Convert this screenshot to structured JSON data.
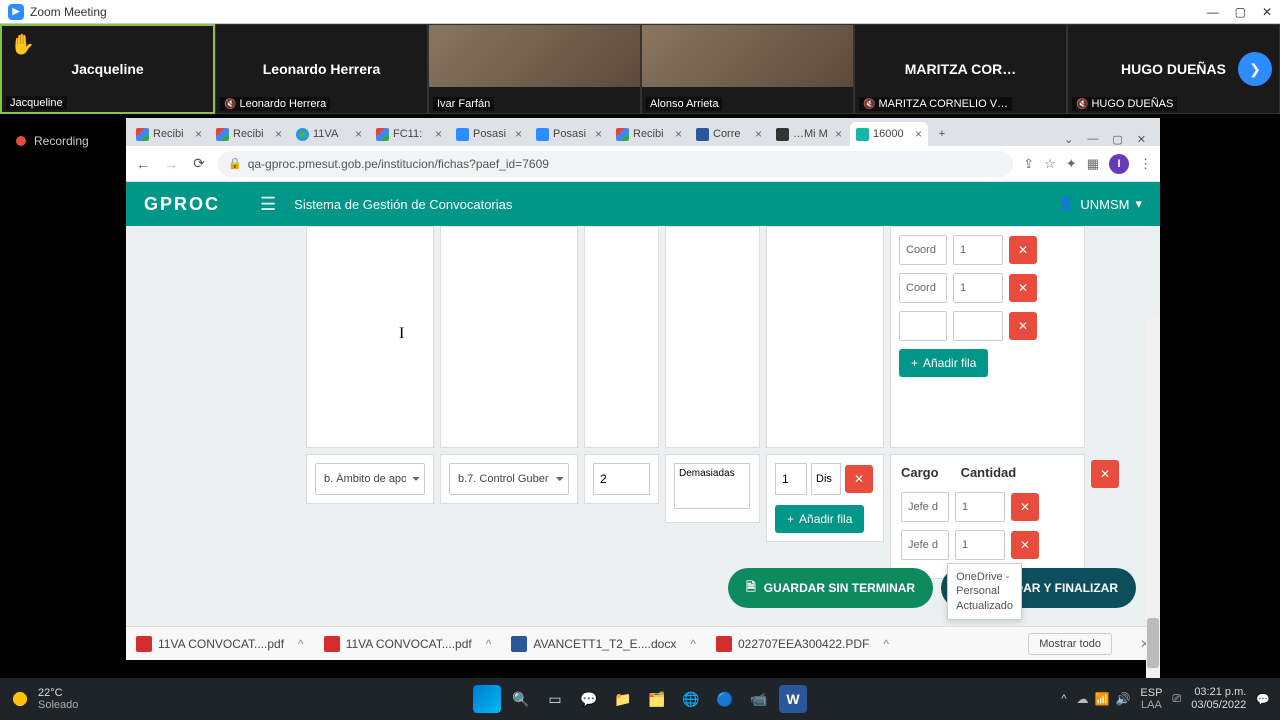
{
  "zoom": {
    "title": "Zoom Meeting",
    "recording": "Recording",
    "tiles": [
      {
        "center": "Jacqueline",
        "bottom": "Jacqueline",
        "hand": true,
        "active": true,
        "video": false,
        "muted": false
      },
      {
        "center": "Leonardo Herrera",
        "bottom": "Leonardo Herrera",
        "hand": false,
        "active": false,
        "video": false,
        "muted": true
      },
      {
        "center": "",
        "bottom": "Ivar Farfán",
        "hand": false,
        "active": false,
        "video": true,
        "muted": false
      },
      {
        "center": "",
        "bottom": "Alonso Arrieta",
        "hand": false,
        "active": false,
        "video": true,
        "muted": false
      },
      {
        "center": "MARITZA  COR…",
        "bottom": "MARITZA CORNELIO V…",
        "hand": false,
        "active": false,
        "video": false,
        "muted": true
      },
      {
        "center": "HUGO DUEÑAS",
        "bottom": "HUGO DUEÑAS",
        "hand": false,
        "active": false,
        "video": false,
        "muted": true
      }
    ]
  },
  "chrome": {
    "tabs": [
      {
        "label": "Recibi",
        "fav": "gmail"
      },
      {
        "label": "Recibi",
        "fav": "gmail"
      },
      {
        "label": "11VA",
        "fav": "globe"
      },
      {
        "label": "FC11:",
        "fav": "gmail"
      },
      {
        "label": "Posasi",
        "fav": "zoom"
      },
      {
        "label": "Posasi",
        "fav": "zoom"
      },
      {
        "label": "Recibi",
        "fav": "gmail"
      },
      {
        "label": "Corre",
        "fav": "word"
      },
      {
        "label": "…Mi M",
        "fav": "dark"
      },
      {
        "label": "16000",
        "fav": "ps",
        "active": true
      }
    ],
    "url": "qa-gproc.pmesut.gob.pe/institucion/fichas?paef_id=7609",
    "avatar_letter": "I"
  },
  "gproc": {
    "logo": "GPROC",
    "subtitle": "Sistema de Gestión de Convocatorias",
    "user": "UNMSM",
    "top_rows": [
      {
        "cargo": "Coord",
        "cantidad": "1"
      },
      {
        "cargo": "Coord",
        "cantidad": "1"
      },
      {
        "cargo": "",
        "cantidad": ""
      }
    ],
    "add_row": "Añadir fila",
    "sel1": "b. Ámbito de apo",
    "sel2": "b.7. Control Guber",
    "num2": "2",
    "textarea": "Demasiadas",
    "spin": "1",
    "dis": "Dis",
    "cargo_hdr": "Cargo",
    "cant_hdr": "Cantidad",
    "bot_rows": [
      {
        "cargo": "Jefe d",
        "cantidad": "1"
      },
      {
        "cargo": "Jefe d",
        "cantidad": "1"
      }
    ],
    "btn_save_draft": "GUARDAR SIN TERMINAR",
    "btn_save_final": "GUARDAR Y FINALIZAR"
  },
  "onedrive": {
    "l1": "OneDrive -",
    "l2": "Personal",
    "l3": "Actualizado"
  },
  "downloads": [
    {
      "name": "11VA CONVOCAT....pdf",
      "type": "pdf"
    },
    {
      "name": "11VA CONVOCAT....pdf",
      "type": "pdf"
    },
    {
      "name": "AVANCETT1_T2_E....docx",
      "type": "doc"
    },
    {
      "name": "022707EEA300422.PDF",
      "type": "pdf"
    }
  ],
  "download_showall": "Mostrar todo",
  "taskbar": {
    "temp": "22°C",
    "cond": "Soleado",
    "lang1": "ESP",
    "lang2": "LAA",
    "time": "03:21 p.m.",
    "date": "03/05/2022"
  }
}
